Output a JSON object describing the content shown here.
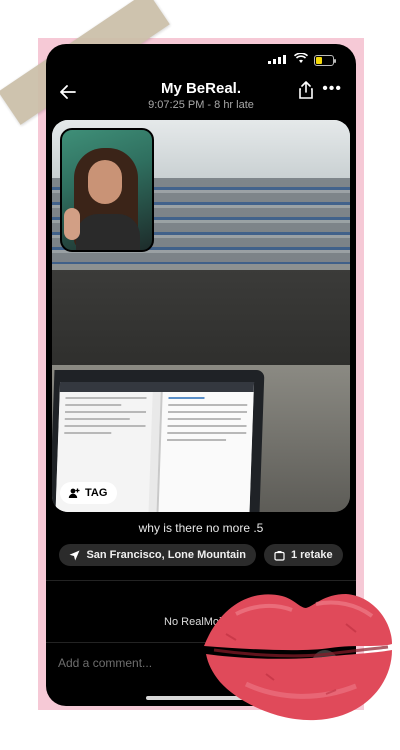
{
  "status_bar": {
    "time": "",
    "battery_color": "#f5d90a"
  },
  "header": {
    "title": "My BeReal.",
    "subtitle": "9:07:25 PM - 8 hr late"
  },
  "photo": {
    "tag_label": "TAG"
  },
  "caption": "why is there no more .5",
  "chips": {
    "location": "San Francisco, Lone Mountain",
    "retakes": "1 retake"
  },
  "realmojis_text": "No RealMojis y",
  "comment": {
    "placeholder": "Add a comment..."
  },
  "colors": {
    "frame_pink": "#f6c9d6",
    "lips_red": "#e04a5a",
    "tape": "#cbbfa8"
  },
  "icons": [
    "back-arrow-icon",
    "share-icon",
    "more-icon",
    "tag-person-icon",
    "location-arrow-icon",
    "retake-icon",
    "send-icon"
  ]
}
